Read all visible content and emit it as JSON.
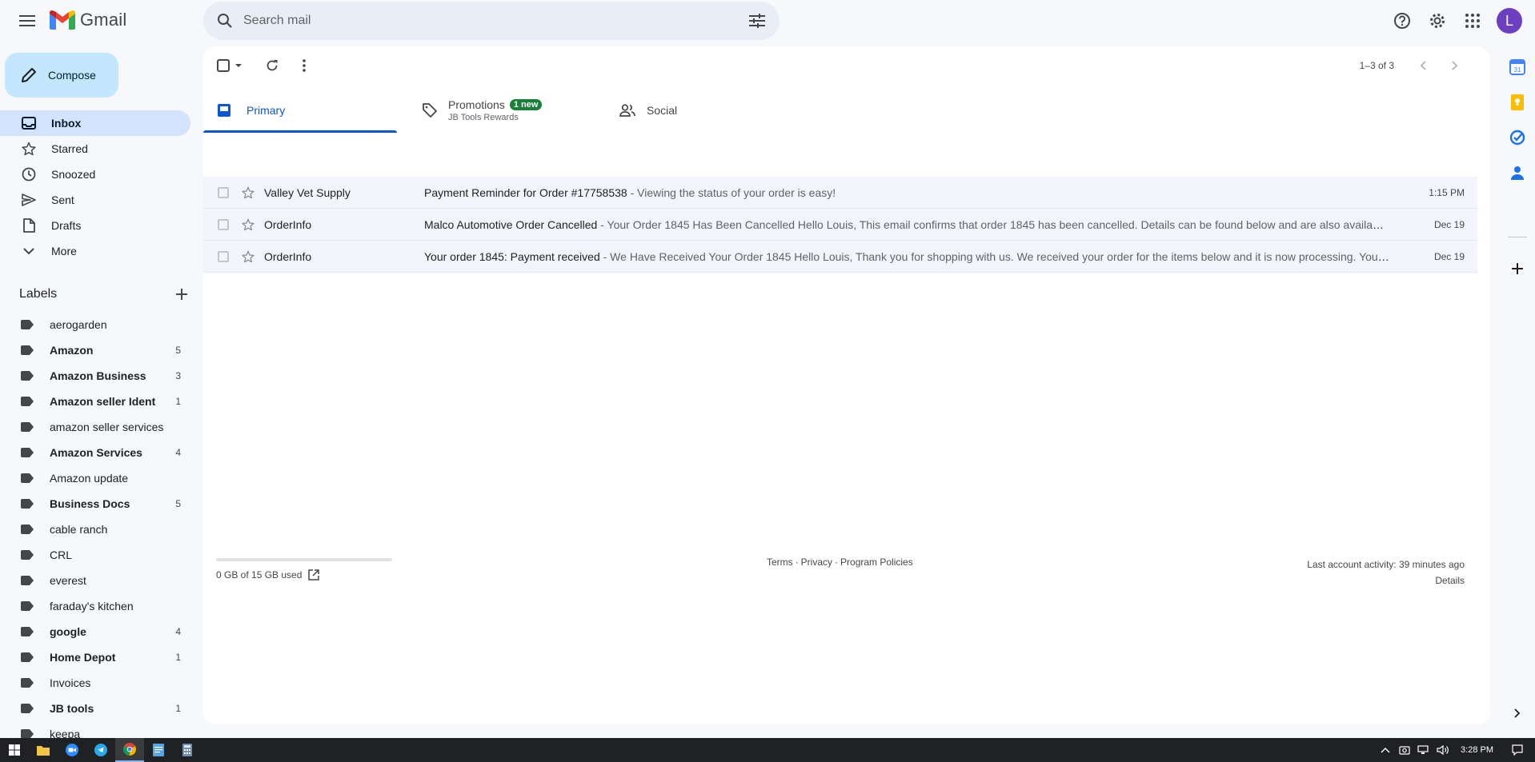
{
  "app": {
    "name": "Gmail"
  },
  "search": {
    "placeholder": "Search mail"
  },
  "account": {
    "initial": "L"
  },
  "compose": {
    "label": "Compose"
  },
  "nav": [
    {
      "label": "Inbox",
      "icon": "inbox-icon",
      "active": true
    },
    {
      "label": "Starred",
      "icon": "star-icon"
    },
    {
      "label": "Snoozed",
      "icon": "clock-icon"
    },
    {
      "label": "Sent",
      "icon": "send-icon"
    },
    {
      "label": "Drafts",
      "icon": "draft-icon"
    },
    {
      "label": "More",
      "icon": "chevron-down-icon"
    }
  ],
  "labels": {
    "title": "Labels",
    "items": [
      {
        "name": "aerogarden",
        "count": "",
        "bold": false
      },
      {
        "name": "Amazon",
        "count": "5",
        "bold": true
      },
      {
        "name": "Amazon Business",
        "count": "3",
        "bold": true
      },
      {
        "name": "Amazon seller Ident",
        "count": "1",
        "bold": true
      },
      {
        "name": "amazon seller services",
        "count": "",
        "bold": false
      },
      {
        "name": "Amazon Services",
        "count": "4",
        "bold": true
      },
      {
        "name": "Amazon update",
        "count": "",
        "bold": false
      },
      {
        "name": "Business Docs",
        "count": "5",
        "bold": true
      },
      {
        "name": "cable ranch",
        "count": "",
        "bold": false
      },
      {
        "name": "CRL",
        "count": "",
        "bold": false
      },
      {
        "name": "everest",
        "count": "",
        "bold": false
      },
      {
        "name": "faraday's kitchen",
        "count": "",
        "bold": false
      },
      {
        "name": "google",
        "count": "4",
        "bold": true
      },
      {
        "name": "Home Depot",
        "count": "1",
        "bold": true
      },
      {
        "name": "Invoices",
        "count": "",
        "bold": false
      },
      {
        "name": "JB tools",
        "count": "1",
        "bold": true
      },
      {
        "name": "keepa",
        "count": "",
        "bold": false
      }
    ]
  },
  "toolbar": {
    "pager": "1–3 of 3"
  },
  "tabs": {
    "primary": "Primary",
    "promotions": "Promotions",
    "promotions_badge": "1 new",
    "promotions_sub": "JB Tools Rewards",
    "social": "Social"
  },
  "emails": [
    {
      "sender": "Valley Vet Supply",
      "subject": "Payment Reminder for Order #17758538",
      "snippet": " - Viewing the status of your order is easy!",
      "date": "1:15 PM"
    },
    {
      "sender": "OrderInfo",
      "subject": "Malco Automotive Order Cancelled",
      "snippet": " - Your Order 1845 Has Been Cancelled Hello Louis, This email confirms that order 1845 has been cancelled. Details can be found below and are also available in your account.",
      "date": "Dec 19"
    },
    {
      "sender": "OrderInfo",
      "subject": "Your order 1845: Payment received",
      "snippet": " - We Have Received Your Order 1845 Hello Louis, Thank you for shopping with us. We received your order for the items below and it is now processing. Your order details are below.",
      "date": "Dec 19"
    }
  ],
  "footer": {
    "storage": "0 GB of 15 GB used",
    "terms": "Terms",
    "privacy": "Privacy",
    "policies": "Program Policies",
    "activity": "Last account activity: 39 minutes ago",
    "details": "Details"
  },
  "taskbar": {
    "time": "3:28 PM"
  },
  "colors": {
    "accent": "#0b57d0",
    "compose_bg": "#c2e7ff",
    "active_nav": "#d3e3fd",
    "badge": "#188038",
    "avatar": "#6b3fbf"
  }
}
